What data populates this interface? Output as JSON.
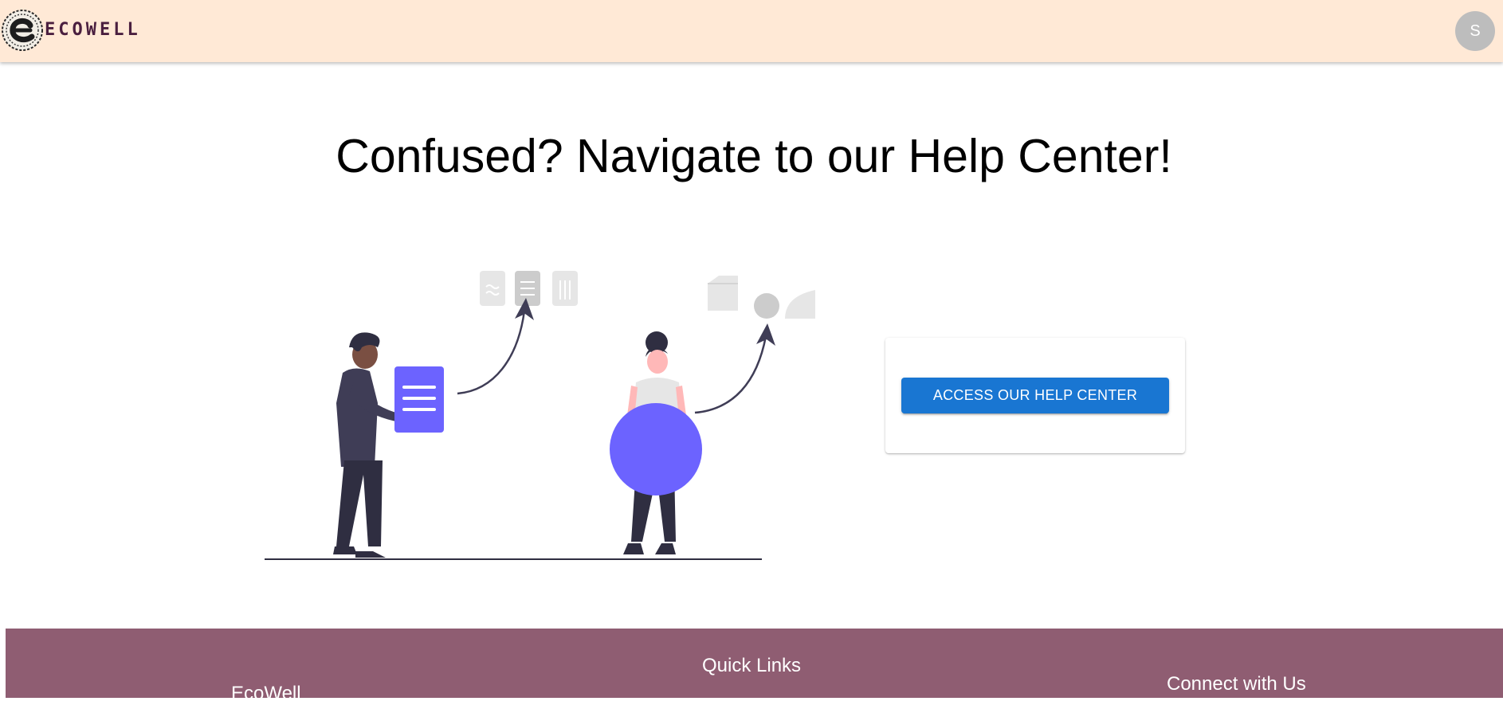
{
  "header": {
    "brand": "ECOWELL",
    "avatar_initial": "S"
  },
  "main": {
    "headline": "Confused? Navigate to our Help Center!",
    "help_button_label": "ACCESS OUR HELP CENTER"
  },
  "footer": {
    "brand": "EcoWell",
    "quick_links_title": "Quick Links",
    "connect_title": "Connect with Us"
  },
  "colors": {
    "header_bg": "#ffe9d6",
    "brand_text": "#4a1f3f",
    "accent_button": "#1976d2",
    "footer_bg": "#8f5d72",
    "illustration_accent": "#6c63ff"
  }
}
